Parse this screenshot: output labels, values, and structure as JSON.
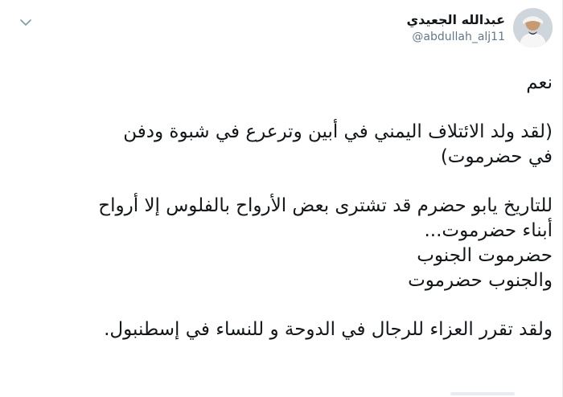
{
  "tweet": {
    "display_name": "عبدالله الجعيدي",
    "handle": "@abdullah_alj11",
    "paragraphs": [
      [
        "نعم"
      ],
      [
        "(لقد ولد الائتلاف اليمني في أبين وترعرع في شبوة ودفن",
        "في حضرموت)"
      ],
      [
        "للتاريخ يابو حضرم قد تشترى بعض الأرواح بالفلوس إلا أرواح",
        "أبناء حضرموت...",
        "حضرموت الجنوب",
        "والجنوب حضرموت"
      ],
      [
        "ولقد تقرر العزاء للرجال في الدوحة و للنساء في إسطنبول."
      ]
    ]
  },
  "icons": {
    "menu": "chevron-down-icon",
    "avatar": "avatar"
  },
  "colors": {
    "text": "#14171a",
    "muted": "#657786",
    "chevron": "#8899a6",
    "border": "#e6ecf0"
  }
}
